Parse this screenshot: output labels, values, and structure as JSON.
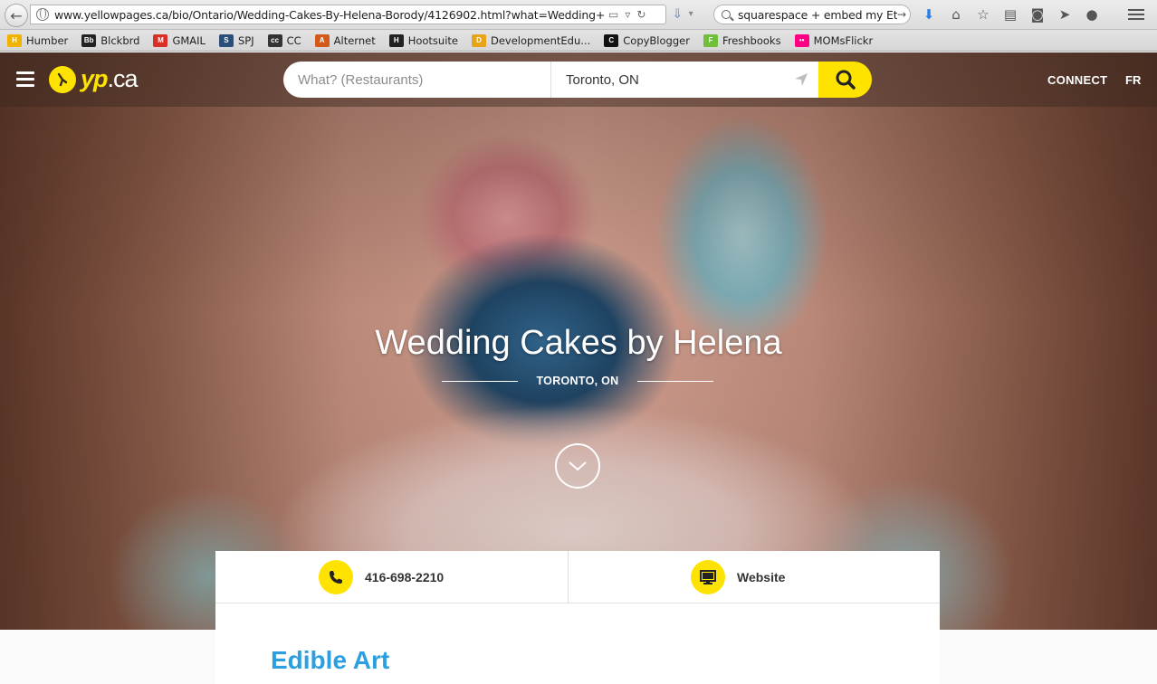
{
  "browser": {
    "url": "www.yellowpages.ca/bio/Ontario/Wedding-Cakes-By-Helena-Borody/4126902.html?what=Wedding+C",
    "search_query": "squarespace + embed my Ets",
    "bookmarks": [
      {
        "label": "Humber",
        "color": "#f0b400",
        "icon_text": "H"
      },
      {
        "label": "Blckbrd",
        "color": "#222222",
        "icon_text": "Bb"
      },
      {
        "label": "GMAIL",
        "color": "#d93025",
        "icon_text": "M"
      },
      {
        "label": "SPJ",
        "color": "#2b4f7a",
        "icon_text": "S"
      },
      {
        "label": "CC",
        "color": "#333333",
        "icon_text": "cc"
      },
      {
        "label": "Alternet",
        "color": "#d45a1c",
        "icon_text": "A"
      },
      {
        "label": "Hootsuite",
        "color": "#222222",
        "icon_text": "H"
      },
      {
        "label": "DevelopmentEdu...",
        "color": "#e8a317",
        "icon_text": "D"
      },
      {
        "label": "CopyBlogger",
        "color": "#111111",
        "icon_text": "C"
      },
      {
        "label": "Freshbooks",
        "color": "#6fbf3b",
        "icon_text": "F"
      },
      {
        "label": "MOMsFlickr",
        "color": "#ff0084",
        "icon_text": "••"
      }
    ]
  },
  "site": {
    "logo_yp": "yp",
    "logo_ca": ".ca",
    "search_what_placeholder": "What? (Restaurants)",
    "search_where_value": "Toronto, ON",
    "connect_label": "CONNECT",
    "lang_label": "FR",
    "accent": "#ffe300"
  },
  "business": {
    "name": "Wedding Cakes by Helena",
    "location": "TORONTO, ON",
    "phone": "416-698-2210",
    "website_label": "Website",
    "section_title": "Edible Art",
    "title_color": "#2b9fe0"
  }
}
